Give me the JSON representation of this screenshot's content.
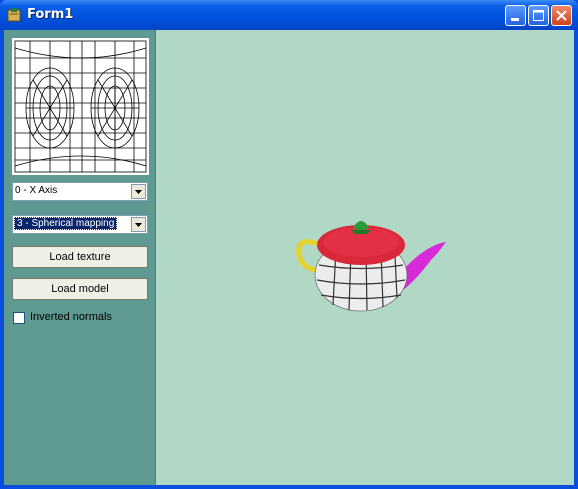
{
  "window": {
    "title": "Form1"
  },
  "panel": {
    "axis_select": {
      "value": "0 - X Axis"
    },
    "mapping_select": {
      "value": "3 - Spherical mapping"
    },
    "load_texture_label": "Load texture",
    "load_model_label": "Load model",
    "inverted_normals": {
      "label": "Inverted normals",
      "checked": false
    }
  },
  "colors": {
    "titlebar": "#0052dc",
    "panel": "#5f9a92",
    "viewport": "#b0d8c4"
  }
}
